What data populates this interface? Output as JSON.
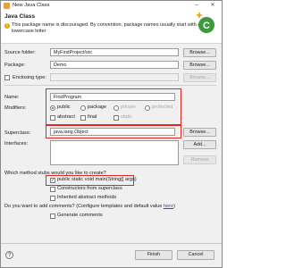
{
  "window": {
    "title": "New Java Class"
  },
  "header": {
    "title": "Java Class",
    "warning": "This package name is discouraged. By convention, package names usually start with a lowercase letter"
  },
  "form": {
    "source_folder": {
      "label": "Source folder:",
      "value": "MyFirstProject/src",
      "button": "Browse..."
    },
    "package": {
      "label": "Package:",
      "value": "Demo",
      "button": "Browse..."
    },
    "enclosing_type": {
      "label": "Enclosing type:",
      "value": "",
      "button": "Browse..."
    },
    "name": {
      "label": "Name:",
      "value": "FirstProgram"
    },
    "modifiers": {
      "label": "Modifiers:",
      "access": [
        "public",
        "package",
        "private",
        "protected"
      ],
      "selected": "public",
      "flags": [
        "abstract",
        "final",
        "static"
      ]
    },
    "superclass": {
      "label": "Superclass:",
      "value": "java.lang.Object",
      "button": "Browse..."
    },
    "interfaces": {
      "label": "Interfaces:",
      "add_button": "Add...",
      "remove_button": "Remove"
    }
  },
  "stubs": {
    "question": "Which method stubs would you like to create?",
    "options": [
      {
        "label": "public static void main(String[] args)",
        "checked": true
      },
      {
        "label": "Constructors from superclass",
        "checked": false
      },
      {
        "label": "Inherited abstract methods",
        "checked": false
      }
    ]
  },
  "comments": {
    "question_prefix": "Do you want to add comments? (Configure templates and default value ",
    "link": "here",
    "question_suffix": ")",
    "option": "Generate comments"
  },
  "footer": {
    "finish": "Finish",
    "cancel": "Cancel"
  },
  "colors": {
    "highlight": "#e0281c",
    "link": "#1a56c6",
    "accent": "#2a6bd6"
  }
}
